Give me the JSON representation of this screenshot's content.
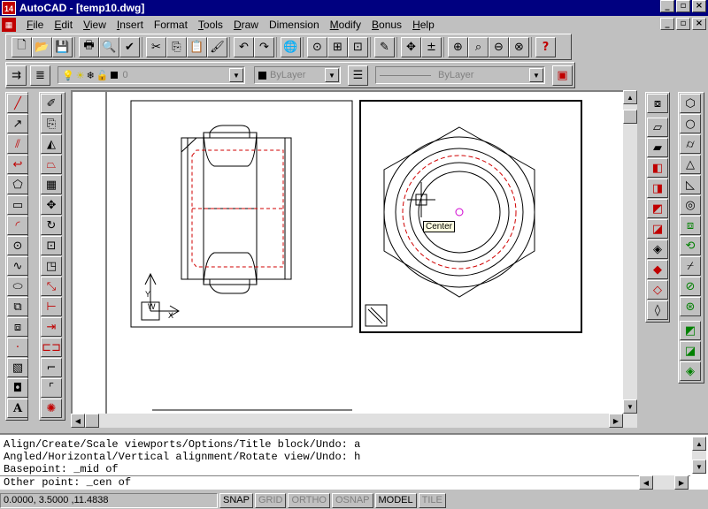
{
  "window": {
    "app_icon_text": "14",
    "title": "AutoCAD - [temp10.dwg]",
    "controls": [
      "_",
      "▫",
      "×"
    ]
  },
  "menubar": {
    "doc_icon_text": "▦",
    "items": [
      {
        "key": "F",
        "rest": "ile"
      },
      {
        "key": "E",
        "rest": "dit"
      },
      {
        "key": "V",
        "rest": "iew"
      },
      {
        "key": "I",
        "rest": "nsert"
      },
      {
        "key": "",
        "rest": "Format"
      },
      {
        "key": "T",
        "rest": "ools"
      },
      {
        "key": "D",
        "rest": "raw"
      },
      {
        "key": "",
        "rest": "Dimension"
      },
      {
        "key": "M",
        "rest": "odify"
      },
      {
        "key": "B",
        "rest": "onus"
      },
      {
        "key": "H",
        "rest": "elp"
      }
    ]
  },
  "layer_toolbar": {
    "layer_name": "0",
    "color_value": "ByLayer",
    "linetype_value": "ByLayer"
  },
  "drawing": {
    "tooltip": "Center",
    "ucs_x": "X",
    "ucs_y": "Y",
    "ucs_w": "W"
  },
  "command_history": [
    "Align/Create/Scale viewports/Options/Title block/Undo: a",
    "Angled/Horizontal/Vertical alignment/Rotate view/Undo: h",
    "Basepoint: _mid of",
    "Other point: _cen of"
  ],
  "status": {
    "coordinates": "0.0000, 3.5000  ,11.4838",
    "toggles": [
      {
        "label": "SNAP",
        "on": true
      },
      {
        "label": "GRID",
        "on": false
      },
      {
        "label": "ORTHO",
        "on": false
      },
      {
        "label": "OSNAP",
        "on": false
      },
      {
        "label": "MODEL",
        "on": true
      },
      {
        "label": "TILE",
        "on": false
      }
    ]
  },
  "colors": {
    "titlebar": "#000080",
    "hidden_line": "#d00000",
    "face": "#c0c0c0"
  }
}
